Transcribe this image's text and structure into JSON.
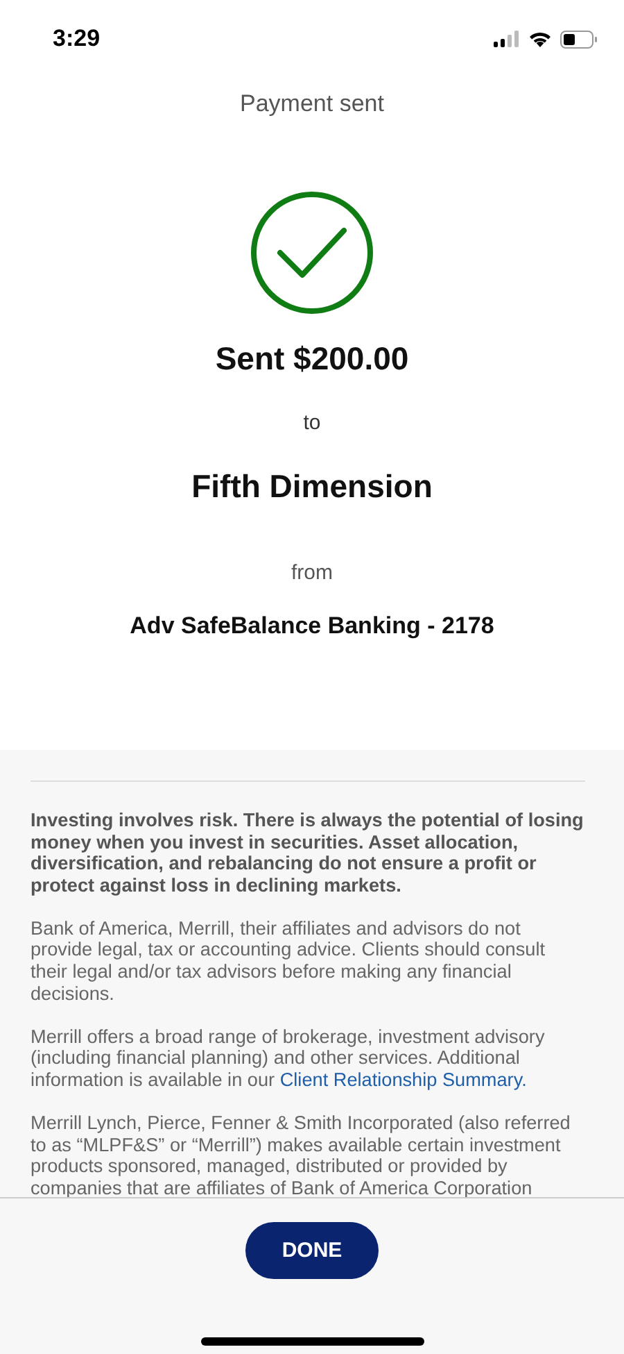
{
  "status_bar": {
    "time": "3:29"
  },
  "header": {
    "title": "Payment sent"
  },
  "confirmation": {
    "amount": "Sent $200.00",
    "to_label": "to",
    "payee": "Fifth Dimension",
    "from_label": "from",
    "account": "Adv SafeBalance Banking - 2178"
  },
  "disclosures": [
    {
      "bold": true,
      "text": "Investing involves risk. There is always the potential of losing money when you invest in securities. Asset allocation, diversification, and rebalancing do not ensure a profit or protect against loss in declining markets."
    },
    {
      "bold": false,
      "text": "Bank of America, Merrill, their affiliates and advisors do not provide legal, tax or accounting advice. Clients should consult their legal and/or tax advisors before making any financial decisions."
    },
    {
      "bold": false,
      "text": "Merrill offers a broad range of brokerage, investment advisory (including financial planning) and other services. Additional information is available in our",
      "link": "Client Relationship Summary."
    },
    {
      "bold": false,
      "text": "Merrill Lynch, Pierce, Fenner & Smith Incorporated (also referred to as “MLPF&S” or “Merrill”) makes available certain investment products sponsored, managed, distributed or provided by companies that are affiliates of Bank of America Corporation"
    }
  ],
  "footer": {
    "button": "DONE"
  }
}
